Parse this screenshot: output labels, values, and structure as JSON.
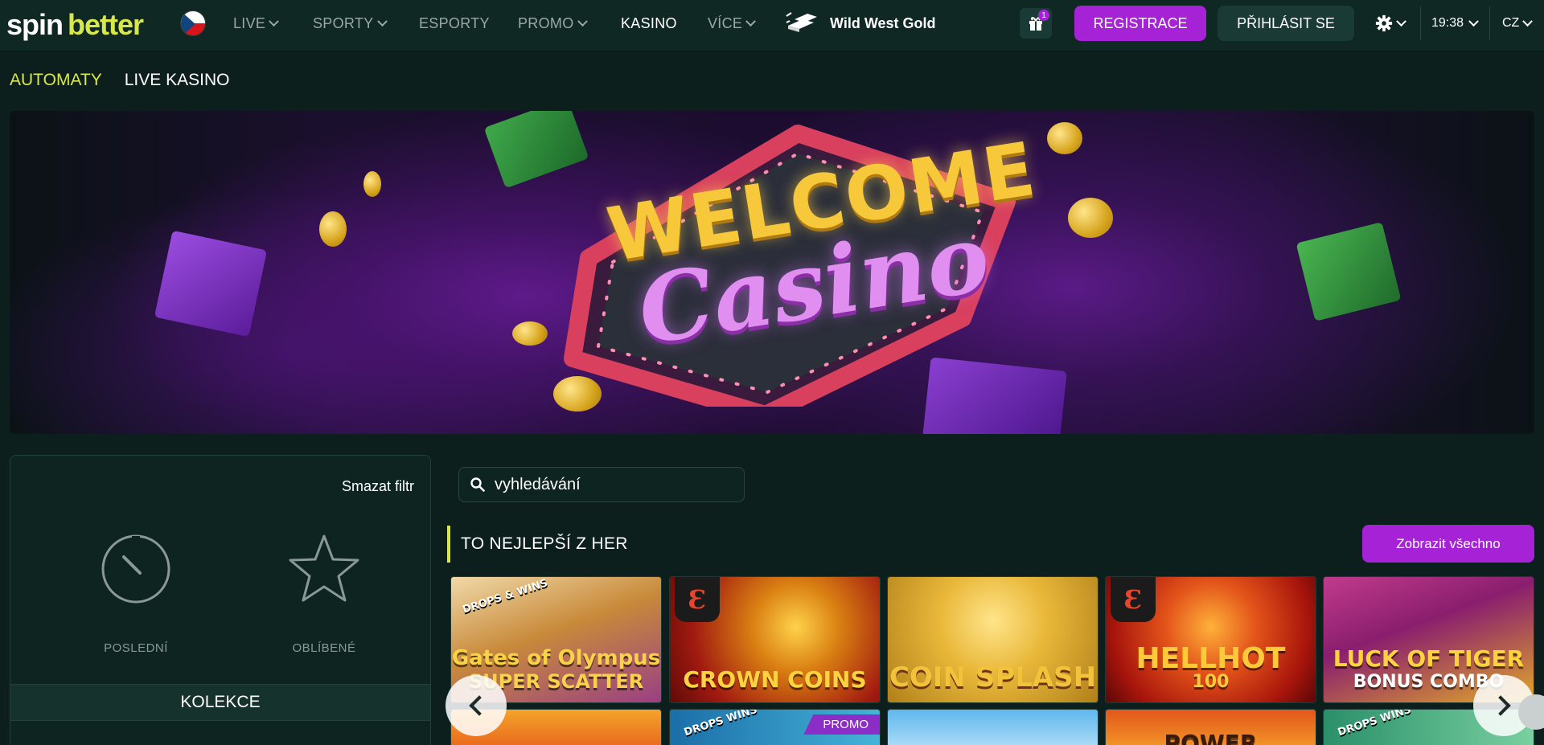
{
  "brand": {
    "logo_part1": "spin",
    "logo_part2": "better",
    "accent": "#d8e84a",
    "primary": "#a522d6",
    "bg": "#0c1f1c"
  },
  "nav": {
    "items": [
      {
        "label": "LIVE",
        "dropdown": true
      },
      {
        "label": "SPORTY",
        "dropdown": true
      },
      {
        "label": "ESPORTY",
        "dropdown": false
      },
      {
        "label": "PROMO",
        "dropdown": true
      },
      {
        "label": "KASINO",
        "dropdown": false,
        "active": true
      },
      {
        "label": "VÍCE",
        "dropdown": true
      }
    ],
    "featured_label": "Wild West Gold",
    "gift_count": "1",
    "register_label": "REGISTRACE",
    "login_label": "PŘIHLÁSIT SE",
    "time": "19:38",
    "language": "CZ"
  },
  "subtabs": [
    {
      "label": "AUTOMATY",
      "active": true
    },
    {
      "label": "LIVE KASINO",
      "active": false
    }
  ],
  "banner": {
    "line1": "WELCOME",
    "line2": "Casino"
  },
  "filter": {
    "clear_label": "Smazat filtr",
    "recent_label": "POSLEDNÍ",
    "favorites_label": "OBLÍBENÉ",
    "collections_label": "KOLEKCE"
  },
  "search": {
    "placeholder": "vyhledávání"
  },
  "section": {
    "title": "TO NEJLEPŠÍ Z HER",
    "show_all_label": "Zobrazit všechno"
  },
  "games_row1": [
    {
      "title": "Gates of Olympus",
      "subtitle": "SUPER SCATTER",
      "badge": "DROPS & WINS"
    },
    {
      "title": "CROWN COINS",
      "subtitle": ""
    },
    {
      "title": "COIN SPLASH",
      "subtitle": ""
    },
    {
      "title": "HELLHOT",
      "subtitle": "100"
    },
    {
      "title": "LUCK OF TIGER",
      "subtitle": "BONUS COMBO"
    }
  ],
  "games_row2": [
    {
      "title": "",
      "badge": ""
    },
    {
      "title": "",
      "badge": "DROPS WINS",
      "tag": "PROMO"
    },
    {
      "title": "",
      "badge": ""
    },
    {
      "title": "POWER",
      "badge": ""
    },
    {
      "title": "",
      "badge": "DROPS WINS"
    }
  ]
}
